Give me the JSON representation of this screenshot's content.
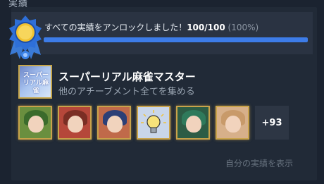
{
  "section": {
    "title": "実績"
  },
  "progress": {
    "message": "すべての実績をアンロックしました！",
    "count": "100/100",
    "percent_text": "(100%)",
    "fraction": 1.0,
    "bar_color": "#3d7ce8"
  },
  "meta_achievement": {
    "icon_text": "スーパーリアル麻雀",
    "title": "スーパーリアル麻雀マスター",
    "description": "他のアチーブメント全てを集める"
  },
  "achievements": [
    {
      "name": "achievement-1",
      "bg": "#6a8f3f",
      "hair": "#3b6b2c"
    },
    {
      "name": "achievement-2",
      "bg": "#b5473a",
      "hair": "#7a2e24"
    },
    {
      "name": "achievement-3",
      "bg": "#c06a4a",
      "hair": "#2c3f76"
    },
    {
      "name": "achievement-4",
      "bg": "#c9d6ea",
      "icon": "lightbulb"
    },
    {
      "name": "achievement-5",
      "bg": "#2d5c45",
      "hair": "#2f7a5b"
    },
    {
      "name": "achievement-6",
      "bg": "#d7b08a",
      "hair": "#c89a6a"
    }
  ],
  "more_count": "+93",
  "show_link": "自分の実績を表示",
  "icons": {
    "badge": "award-badge-icon",
    "lightbulb": "lightbulb-icon"
  },
  "colors": {
    "panel": "#212a37",
    "gold_border": "#c9a34a"
  }
}
